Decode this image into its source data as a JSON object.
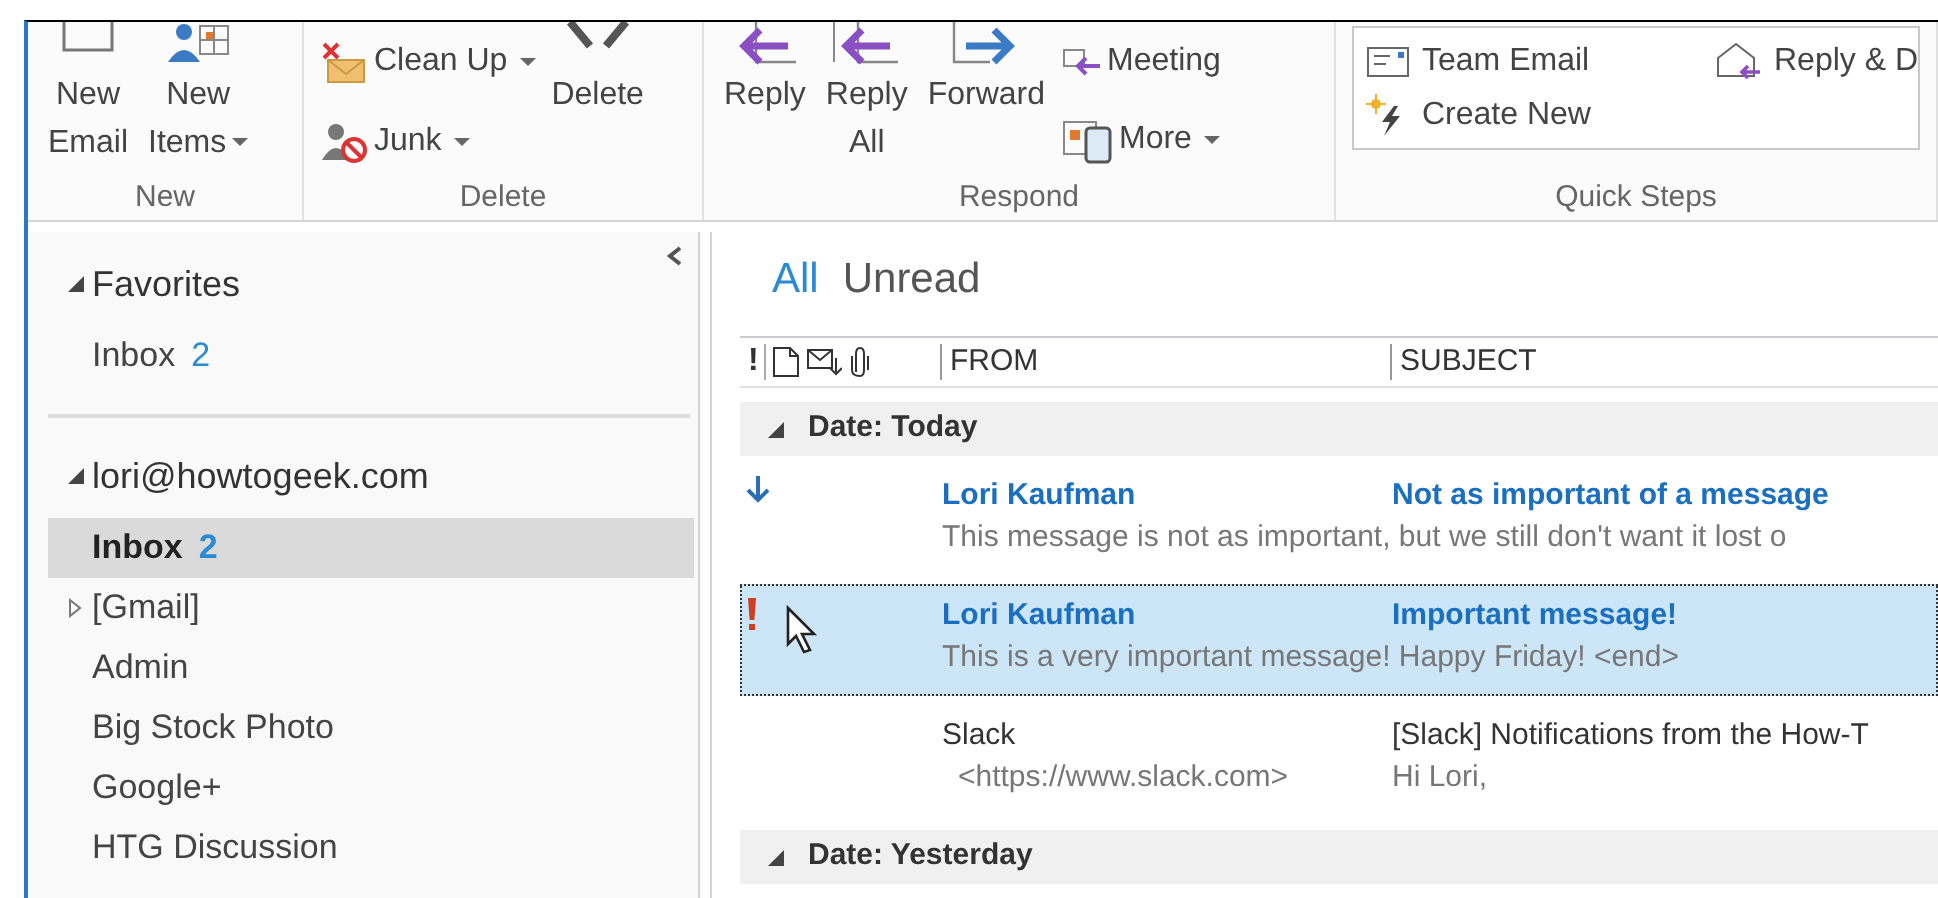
{
  "ribbon": {
    "groups": [
      {
        "label": "New",
        "items": [
          {
            "kind": "large",
            "lines": [
              "New",
              "Email"
            ],
            "dropdown": false
          },
          {
            "kind": "large",
            "lines": [
              "New",
              "Items"
            ],
            "dropdown": true
          }
        ]
      },
      {
        "label": "Delete",
        "items": [
          {
            "kind": "stack",
            "entries": [
              {
                "label": "Clean Up",
                "dropdown": true
              },
              {
                "label": "Junk",
                "dropdown": true
              }
            ]
          },
          {
            "kind": "large",
            "lines": [
              "Delete"
            ],
            "dropdown": false
          }
        ]
      },
      {
        "label": "Respond",
        "items": [
          {
            "kind": "large",
            "lines": [
              "Reply"
            ],
            "dropdown": false
          },
          {
            "kind": "large",
            "lines": [
              "Reply",
              "All"
            ],
            "dropdown": false
          },
          {
            "kind": "large",
            "lines": [
              "Forward"
            ],
            "dropdown": false
          },
          {
            "kind": "stack",
            "entries": [
              {
                "label": "Meeting",
                "dropdown": false
              },
              {
                "label": "More",
                "dropdown": true
              }
            ]
          }
        ]
      },
      {
        "label": "Quick Steps",
        "items": [
          {
            "kind": "quicksteps",
            "entries": [
              {
                "label": "Team Email"
              },
              {
                "label": "Reply & D"
              },
              {
                "label": "Create New"
              }
            ]
          }
        ]
      }
    ]
  },
  "folders": {
    "sections": [
      {
        "title": "Favorites",
        "expanded": true,
        "items": [
          {
            "kind": "folder",
            "label": "Inbox",
            "count": "2",
            "selected": false
          }
        ]
      },
      {
        "title": "lori@howtogeek.com",
        "expanded": true,
        "items": [
          {
            "kind": "folder",
            "label": "Inbox",
            "count": "2",
            "selected": true
          },
          {
            "kind": "collapsed",
            "label": "[Gmail]",
            "selected": false
          },
          {
            "kind": "folder",
            "label": "Admin",
            "selected": false
          },
          {
            "kind": "folder",
            "label": "Big Stock Photo",
            "selected": false
          },
          {
            "kind": "folder",
            "label": "Google+",
            "selected": false
          },
          {
            "kind": "folder",
            "label": "HTG Discussion",
            "selected": false
          }
        ]
      }
    ]
  },
  "messages": {
    "filters": [
      {
        "label": "All",
        "selected": true
      },
      {
        "label": "Unread",
        "selected": false
      }
    ],
    "importance_header": "!",
    "columns": [
      "FROM",
      "SUBJECT"
    ],
    "groups": [
      {
        "label": "Date: Today",
        "expanded": true,
        "items": [
          {
            "kind": "low",
            "unread": true,
            "selected": false,
            "from": "Lori Kaufman",
            "subject": "Not as important of a message",
            "preview": "This message is not as important, but we still don't want it lost o"
          },
          {
            "kind": "high",
            "unread": true,
            "selected": true,
            "from": "Lori Kaufman",
            "subject": "Important message!",
            "preview": "This is a very important message! Happy Friday! <end>"
          },
          {
            "kind": "normal",
            "unread": false,
            "selected": false,
            "from": "Slack",
            "from_detail": "<https://www.slack.com>",
            "subject": "[Slack] Notifications from the How-T",
            "preview": "Hi Lori,"
          }
        ]
      },
      {
        "label": "Date: Yesterday",
        "expanded": true
      }
    ]
  }
}
